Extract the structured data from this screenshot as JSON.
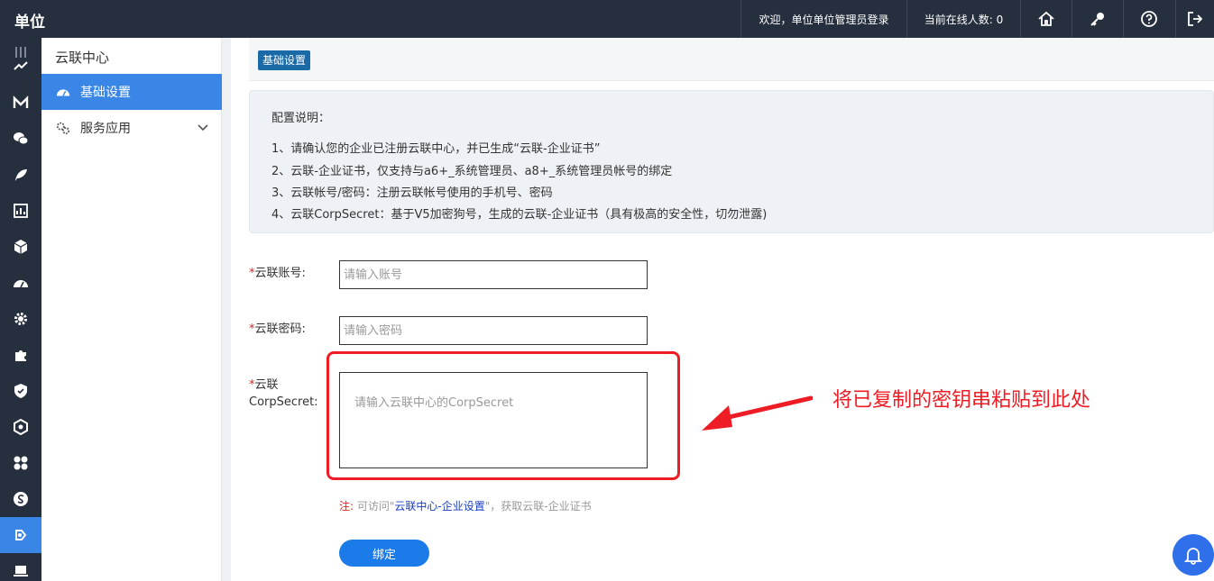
{
  "header": {
    "title": "单位",
    "welcome": "欢迎，单位单位管理员登录",
    "online": "当前在线人数: 0",
    "icons": [
      "home-icon",
      "key-icon",
      "help-icon",
      "logout-icon"
    ]
  },
  "rail": {
    "icons": [
      "menu-collapse-icon",
      "approval-icon",
      "mail-icon",
      "wechat-icon",
      "feather-icon",
      "report-icon",
      "cube-icon",
      "dashboard-icon",
      "gear-icon",
      "puzzle-icon",
      "shield-icon",
      "hexagon-icon",
      "apps-icon",
      "money-icon",
      "cloud-link-icon",
      "computer-icon"
    ],
    "active": "cloud-link-icon"
  },
  "sidebar": {
    "title": "云联中心",
    "items": [
      {
        "label": "基础设置",
        "icon": "dashboard-icon",
        "active": true
      },
      {
        "label": "服务应用",
        "icon": "gears-icon",
        "active": false
      }
    ]
  },
  "tab": {
    "label": "基础设置"
  },
  "notes": {
    "title": "配置说明：",
    "lines": [
      "1、请确认您的企业已注册云联中心，并已生成“云联-企业证书”",
      "2、云联-企业证书，仅支持与a6+_系统管理员、a8+_系统管理员帐号的绑定",
      "3、云联帐号/密码：注册云联帐号使用的手机号、密码",
      "4、云联CorpSecret：基于V5加密狗号，生成的云联-企业证书（具有极高的安全性，切勿泄露)"
    ]
  },
  "form": {
    "required_mark": "*",
    "account_label": "云联账号:",
    "account_placeholder": "请输入账号",
    "password_label": "云联密码:",
    "password_placeholder": "请输入密码",
    "secret_label_1": "云联",
    "secret_label_2": "CorpSecret:",
    "secret_placeholder": "请输入云联中心的CorpSecret",
    "note_prefix": "注:",
    "note_before": "可访问\"",
    "note_link": "云联中心-企业设置",
    "note_after": "\"，获取云联-企业证书",
    "submit_label": "绑定"
  },
  "annotation": {
    "text": "将已复制的密钥串粘贴到此处",
    "color": "#ee1c24"
  },
  "colors": {
    "topbar": "#262f3e",
    "accent": "#3a86e6",
    "button": "#1b7be8"
  }
}
